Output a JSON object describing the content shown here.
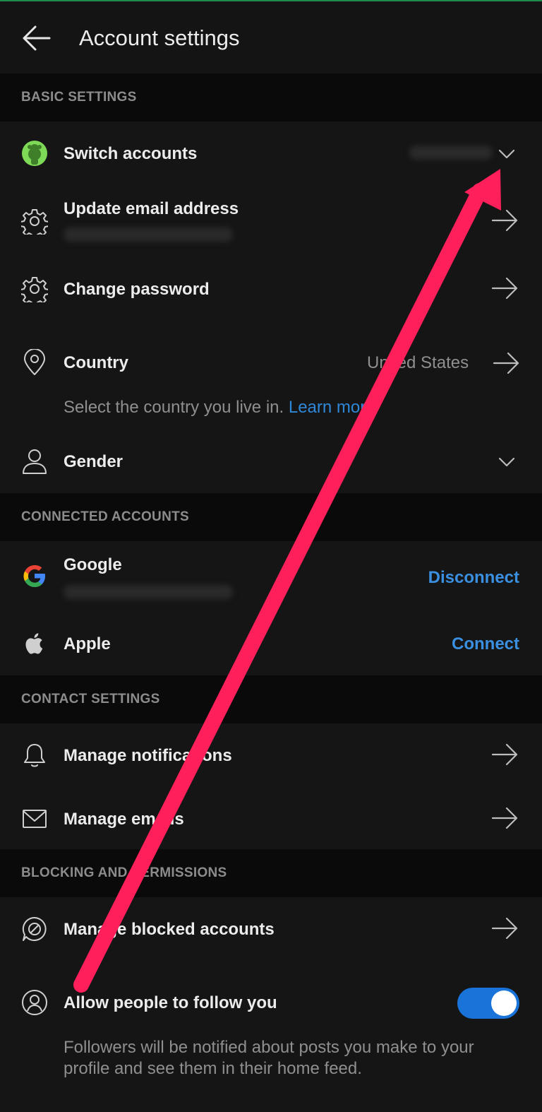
{
  "header": {
    "title": "Account settings",
    "back_icon": "arrow-left-icon"
  },
  "sections": {
    "basic": "BASIC SETTINGS",
    "connected": "CONNECTED ACCOUNTS",
    "contact": "CONTACT SETTINGS",
    "blocking": "BLOCKING AND PERMISSIONS"
  },
  "basic": {
    "switch_accounts": "Switch accounts",
    "update_email": "Update email address",
    "change_password": "Change password",
    "country": "Country",
    "country_value": "United States",
    "country_helper": "Select the country you live in.",
    "country_learn_more": "Learn more",
    "gender": "Gender"
  },
  "connected": {
    "google": "Google",
    "google_action": "Disconnect",
    "apple": "Apple",
    "apple_action": "Connect"
  },
  "contact": {
    "notifications": "Manage notifications",
    "emails": "Manage emails"
  },
  "blocking": {
    "blocked": "Manage blocked accounts",
    "follow": "Allow people to follow you",
    "follow_helper": "Followers will be notified about posts you make to your profile and see them in their home feed.",
    "follow_enabled": true
  },
  "colors": {
    "accent": "#3a8fe0",
    "toggle_on": "#1a73d9",
    "annotation_arrow": "#ff1f5a",
    "avatar_green": "#7ed957"
  },
  "icons": {
    "avatar": "reddit-avatar-icon",
    "gear": "gear-icon",
    "location": "location-pin-icon",
    "person": "person-icon",
    "google": "google-logo-icon",
    "apple": "apple-logo-icon",
    "bell": "bell-icon",
    "mail": "mail-icon",
    "blocked": "blocked-chat-icon",
    "follow": "person-circle-icon"
  }
}
